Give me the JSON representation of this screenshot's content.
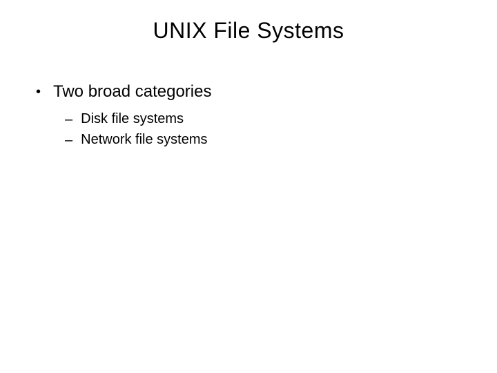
{
  "slide": {
    "title": "UNIX File Systems",
    "bullets": [
      {
        "marker": "•",
        "text": "Two broad categories",
        "subitems": [
          {
            "marker": "–",
            "text": "Disk file systems"
          },
          {
            "marker": "–",
            "text": "Network file systems"
          }
        ]
      }
    ]
  }
}
